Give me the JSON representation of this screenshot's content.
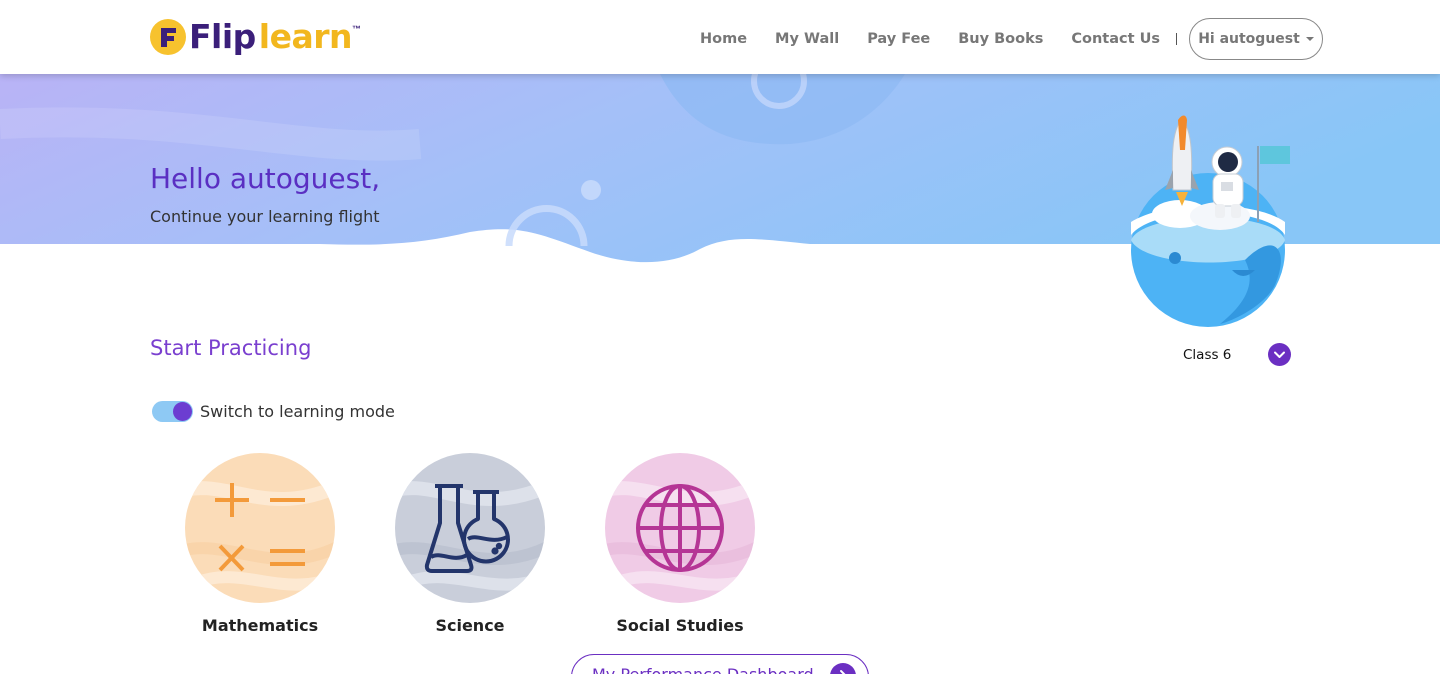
{
  "header": {
    "logo_text_dark": "Flip",
    "logo_text_light": "learn",
    "logo_tm": "™",
    "nav": [
      {
        "label": "Home"
      },
      {
        "label": "My Wall"
      },
      {
        "label": "Pay Fee"
      },
      {
        "label": "Buy Books"
      },
      {
        "label": "Contact Us"
      }
    ],
    "user_menu_label": "Hi autoguest"
  },
  "hero": {
    "greeting": "Hello autoguest,",
    "subtitle": "Continue your learning flight"
  },
  "practice": {
    "title": "Start Practicing",
    "class_select_value": "Class 6",
    "mode_toggle_label": "Switch to learning mode",
    "mode_toggle_on": true,
    "subjects": [
      {
        "name": "Mathematics",
        "icon": "math-operators-icon",
        "bg": "#fad9b3",
        "accent": "#f39a3a"
      },
      {
        "name": "Science",
        "icon": "flasks-icon",
        "bg": "#c6ccda",
        "accent": "#23356b"
      },
      {
        "name": "Social Studies",
        "icon": "globe-icon",
        "bg": "#efc8e4",
        "accent": "#b53595"
      }
    ],
    "dashboard_button_label": "My Performance Dashboard"
  },
  "colors": {
    "brand_purple": "#6b2fc2",
    "brand_yellow": "#f2b71e",
    "hero_gradient_start": "#b4b2f6",
    "hero_gradient_end": "#88c6f7"
  }
}
